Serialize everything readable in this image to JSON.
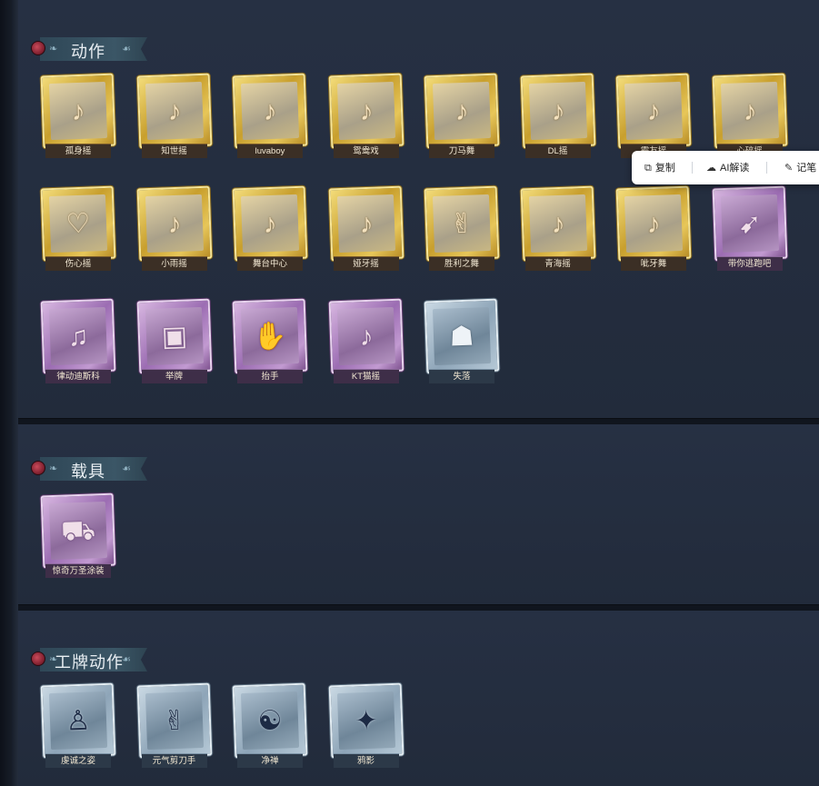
{
  "sections": [
    {
      "title": "动作",
      "items": [
        {
          "label": "孤身摇",
          "rarity": "gold",
          "icon": "figure-dance-icon"
        },
        {
          "label": "知世摇",
          "rarity": "gold",
          "icon": "figure-dance-icon"
        },
        {
          "label": "luvaboy",
          "rarity": "gold",
          "icon": "figure-dance-icon"
        },
        {
          "label": "鸳鸯戏",
          "rarity": "gold",
          "icon": "figure-dance-icon"
        },
        {
          "label": "刀马舞",
          "rarity": "gold",
          "icon": "figure-dance-icon"
        },
        {
          "label": "DL摇",
          "rarity": "gold",
          "icon": "figure-dance-icon"
        },
        {
          "label": "霸友摇",
          "rarity": "gold",
          "icon": "figure-dance-icon"
        },
        {
          "label": "心碎摇",
          "rarity": "gold",
          "icon": "figure-dance-icon"
        },
        {
          "label": "伤心摇",
          "rarity": "gold",
          "icon": "figure-heart-icon"
        },
        {
          "label": "小雨摇",
          "rarity": "gold",
          "icon": "figure-dance-icon"
        },
        {
          "label": "舞台中心",
          "rarity": "gold",
          "icon": "figure-dance-icon"
        },
        {
          "label": "娅牙摇",
          "rarity": "gold",
          "icon": "figure-dance-icon"
        },
        {
          "label": "胜利之舞",
          "rarity": "gold",
          "icon": "figure-victory-icon"
        },
        {
          "label": "青海摇",
          "rarity": "gold",
          "icon": "figure-dance-icon"
        },
        {
          "label": "呲牙舞",
          "rarity": "gold",
          "icon": "figure-dance-icon"
        },
        {
          "label": "带你逃跑吧",
          "rarity": "purple",
          "icon": "figure-run-icon"
        },
        {
          "label": "律动迪斯科",
          "rarity": "purple",
          "icon": "figure-disco-icon"
        },
        {
          "label": "举牌",
          "rarity": "purple",
          "icon": "sign-board-icon"
        },
        {
          "label": "抬手",
          "rarity": "purple",
          "icon": "figure-raise-hand-icon"
        },
        {
          "label": "KT猫摇",
          "rarity": "purple",
          "icon": "figure-dance-icon"
        },
        {
          "label": "失落",
          "rarity": "blue",
          "icon": "figure-kneel-icon"
        }
      ]
    },
    {
      "title": "载具",
      "items": [
        {
          "label": "惊奇万圣涂装",
          "rarity": "purple",
          "icon": "vehicle-truck-icon"
        }
      ]
    },
    {
      "title": "工牌动作",
      "items": [
        {
          "label": "虔诚之姿",
          "rarity": "blue",
          "icon": "badge-figure-icon"
        },
        {
          "label": "元气剪刀手",
          "rarity": "blue",
          "icon": "badge-peace-sign-icon"
        },
        {
          "label": "净禅",
          "rarity": "blue",
          "icon": "badge-meditate-icon"
        },
        {
          "label": "鸦影",
          "rarity": "blue",
          "icon": "badge-crow-icon"
        }
      ]
    }
  ],
  "popup": {
    "copy_label": "复制",
    "ai_label": "AI解读",
    "note_label": "记笔"
  },
  "colors": {
    "background": "#1f2838",
    "gold": "#d4af3a",
    "purple": "#a77bbd",
    "blue": "#9cb2c4",
    "header_ribbon": "#36505f"
  }
}
